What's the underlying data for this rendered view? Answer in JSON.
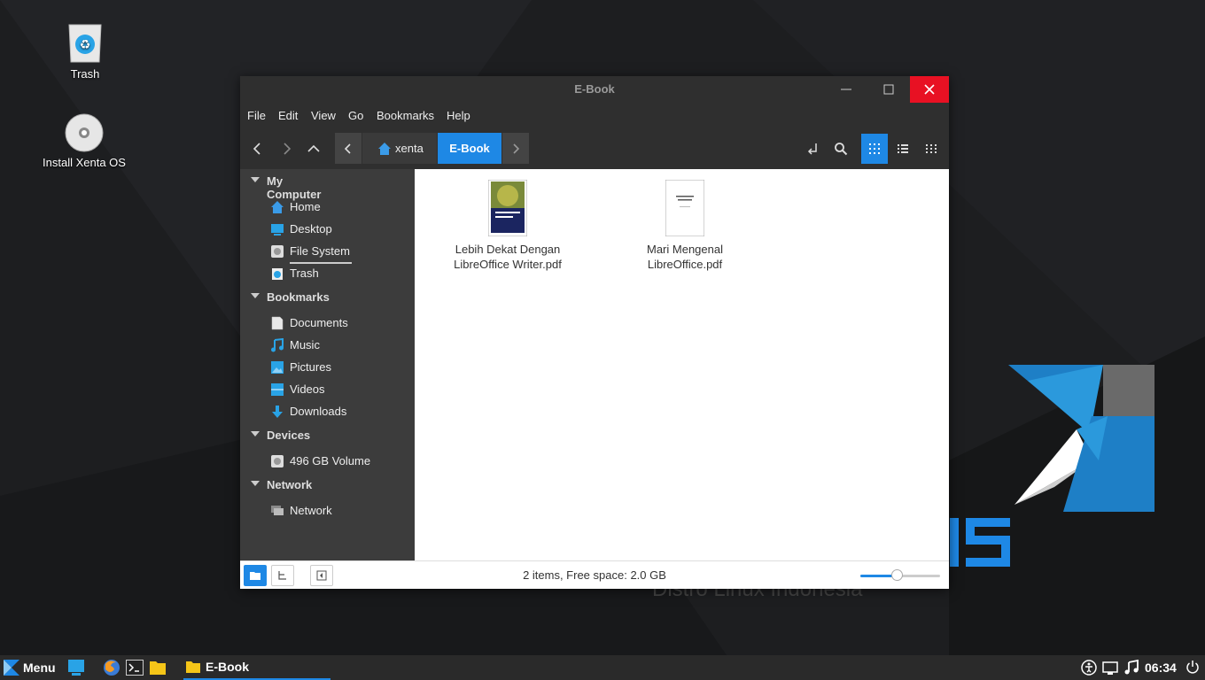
{
  "desktop": {
    "icons": [
      {
        "label": "Trash",
        "icon": "trash-icon"
      },
      {
        "label": "Install Xenta OS",
        "icon": "disc-icon"
      }
    ],
    "wallpaper_text": {
      "brand": "IS",
      "tagline": "Distro Linux Indonesia"
    }
  },
  "window": {
    "title": "E-Book",
    "menu": [
      "File",
      "Edit",
      "View",
      "Go",
      "Bookmarks",
      "Help"
    ],
    "breadcrumb": [
      "xenta",
      "E-Book"
    ],
    "sidebar": {
      "sections": [
        {
          "title": "My Computer",
          "items": [
            {
              "label": "Home",
              "icon": "home-icon"
            },
            {
              "label": "Desktop",
              "icon": "desktop-icon"
            },
            {
              "label": "File System",
              "icon": "drive-icon"
            },
            {
              "label": "Trash",
              "icon": "trash-icon"
            }
          ]
        },
        {
          "title": "Bookmarks",
          "items": [
            {
              "label": "Documents",
              "icon": "documents-icon"
            },
            {
              "label": "Music",
              "icon": "music-icon"
            },
            {
              "label": "Pictures",
              "icon": "pictures-icon"
            },
            {
              "label": "Videos",
              "icon": "videos-icon"
            },
            {
              "label": "Downloads",
              "icon": "downloads-icon"
            }
          ]
        },
        {
          "title": "Devices",
          "items": [
            {
              "label": "496 GB Volume",
              "icon": "drive-icon"
            }
          ]
        },
        {
          "title": "Network",
          "items": [
            {
              "label": "Network",
              "icon": "network-icon"
            }
          ]
        }
      ]
    },
    "files": [
      {
        "name_line1": "Lebih Dekat Dengan",
        "name_line2": "LibreOffice Writer.pdf"
      },
      {
        "name_line1": "Mari Mengenal",
        "name_line2": "LibreOffice.pdf"
      }
    ],
    "status": "2 items, Free space: 2.0 GB",
    "zoom_level": 0.45
  },
  "taskbar": {
    "menu_label": "Menu",
    "active_window": "E-Book",
    "clock": "06:34"
  },
  "colors": {
    "accent": "#1e88e5",
    "close": "#e81123",
    "sidebar": "#3c3c3c",
    "titlebar": "#2f2f2f"
  }
}
